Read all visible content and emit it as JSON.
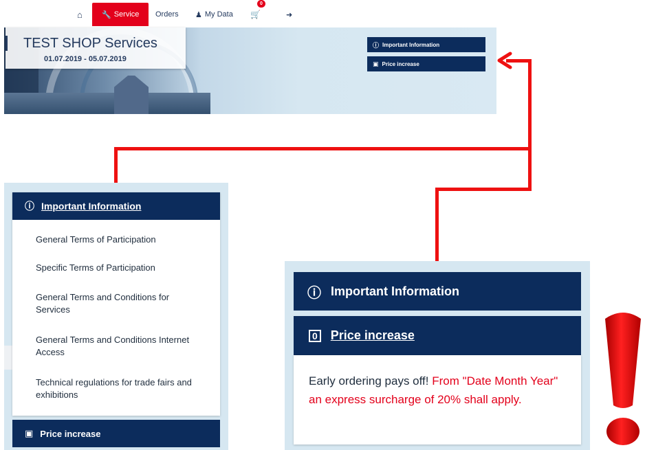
{
  "nav": {
    "home_icon": "home-icon",
    "service_label": "Service",
    "orders_label": "Orders",
    "mydata_label": "My Data",
    "cart_count": "0",
    "logout_icon": "logout-icon"
  },
  "banner": {
    "title": "TEST SHOP Services",
    "dates": "01.07.2019 - 05.07.2019",
    "important_btn": "Important Information",
    "price_btn": "Price increase"
  },
  "left_panel": {
    "heading": "Important Information",
    "links": [
      "General Terms of Participation",
      "Specific Terms of Participation",
      "General Terms and Conditions for Services",
      "General Terms and Conditions Internet Access",
      "Technical regulations for trade fairs and exhibitions"
    ],
    "footer_label": "Price increase"
  },
  "right_panel": {
    "heading": "Important Information",
    "price_heading": "Price increase",
    "text_normal": "Early ordering pays off! ",
    "text_warn": "From \"Date Month Year\" an express surcharge of 20% shall apply."
  },
  "colors": {
    "navy": "#0c2c5c",
    "accent_red": "#e3001b",
    "panel_bg": "#d6e7f1"
  }
}
